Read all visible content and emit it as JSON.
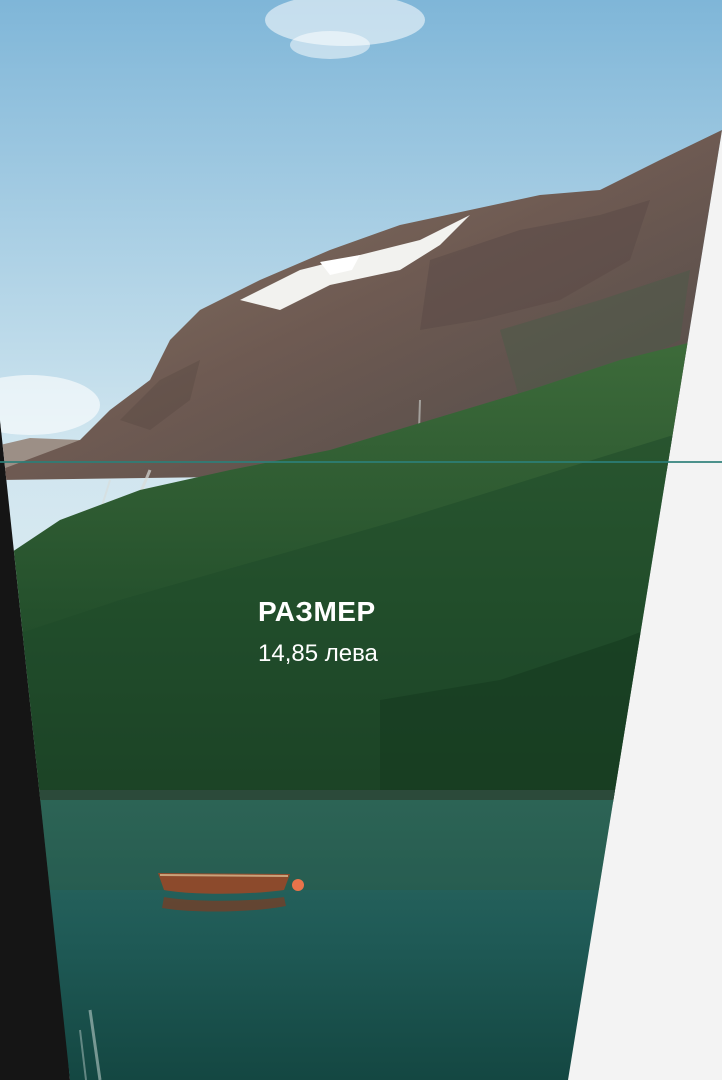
{
  "size": {
    "title": "РАЗМЕР",
    "value": "14,85 лева"
  },
  "colors": {
    "accent_line": "#2d7f78",
    "background": "#f3f3f3",
    "dark_strip": "#151515"
  },
  "icons": {
    "photo": "mountain-fjord-photo"
  }
}
